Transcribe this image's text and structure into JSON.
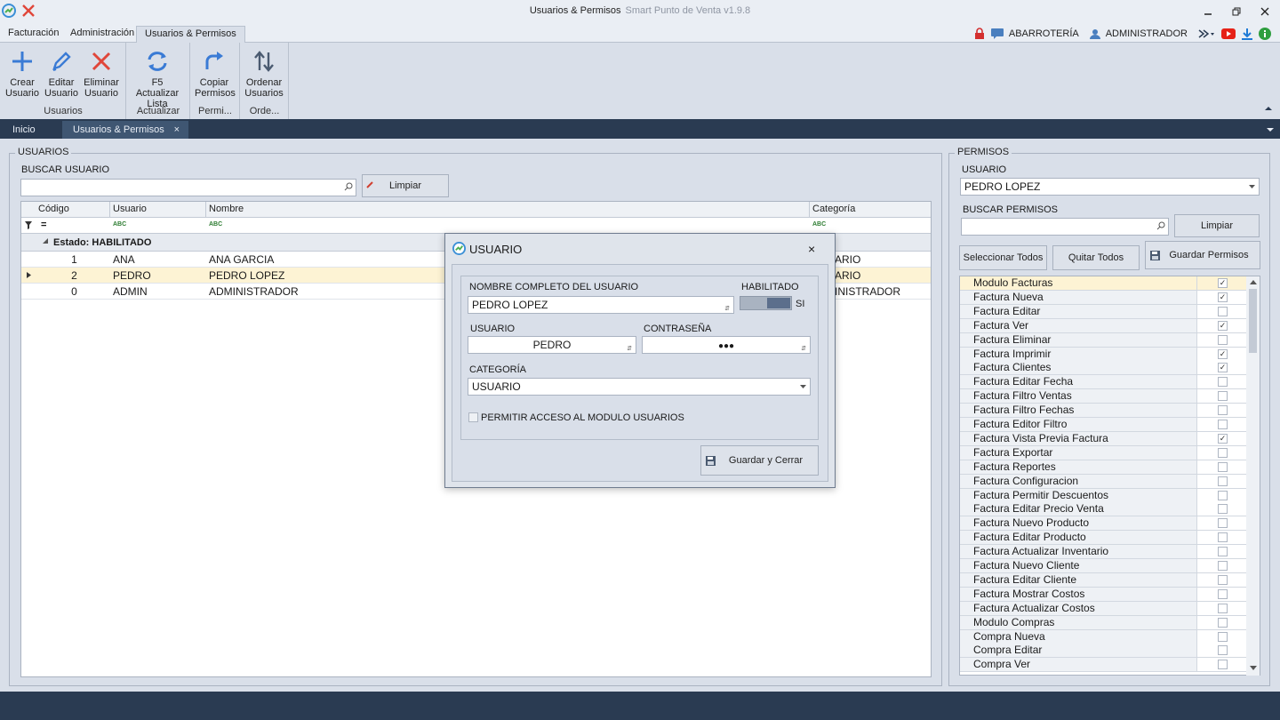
{
  "window": {
    "title": "Usuarios & Permisos",
    "app_name": "Smart Punto de Venta v1.9.8"
  },
  "ribbon_tabs": [
    "Facturación",
    "Administración",
    "Usuarios & Permisos"
  ],
  "header_right": {
    "store": "ABARROTERÍA",
    "user": "ADMINISTRADOR"
  },
  "ribbon": {
    "crear": "Crear\nUsuario",
    "editar": "Editar\nUsuario",
    "eliminar": "Eliminar\nUsuario",
    "actualizar": "F5 Actualizar\nLista",
    "copiar": "Copiar\nPermisos",
    "ordenar": "Ordenar\nUsuarios",
    "group_usuarios": "Usuarios",
    "group_actualizar": "Actualizar",
    "group_permisos": "Permi...",
    "group_orden": "Orde..."
  },
  "doc_tabs": [
    "Inicio",
    "Usuarios & Permisos"
  ],
  "usuarios_panel": {
    "title": "USUARIOS",
    "search_label": "BUSCAR USUARIO",
    "search_value": "",
    "clear_button": "Limpiar",
    "columns": [
      "Código",
      "Usuario",
      "Nombre",
      "Categoría"
    ],
    "filter_eq": "=",
    "filter_abc": "ABC",
    "group_header": "Estado: HABILITADO",
    "rows": [
      {
        "codigo": "1",
        "usuario": "ANA",
        "nombre": "ANA GARCIA",
        "categoria": "ARIO"
      },
      {
        "codigo": "2",
        "usuario": "PEDRO",
        "nombre": "PEDRO LOPEZ",
        "categoria": "ARIO"
      },
      {
        "codigo": "0",
        "usuario": "ADMIN",
        "nombre": "ADMINISTRADOR",
        "categoria": "INISTRADOR"
      }
    ]
  },
  "permisos_panel": {
    "title": "PERMISOS",
    "user_label": "USUARIO",
    "user_value": "PEDRO LOPEZ",
    "search_label": "BUSCAR PERMISOS",
    "search_value": "",
    "clear_button": "Limpiar",
    "select_all": "Seleccionar Todos",
    "remove_all": "Quitar Todos",
    "save": "Guardar Permisos",
    "items": [
      {
        "label": "Modulo Facturas",
        "checked": true
      },
      {
        "label": "Factura Nueva",
        "checked": true
      },
      {
        "label": "Factura Editar",
        "checked": false
      },
      {
        "label": "Factura Ver",
        "checked": true
      },
      {
        "label": "Factura Eliminar",
        "checked": false
      },
      {
        "label": "Factura Imprimir",
        "checked": true
      },
      {
        "label": "Factura Clientes",
        "checked": true
      },
      {
        "label": "Factura Editar Fecha",
        "checked": false
      },
      {
        "label": "Factura Filtro Ventas",
        "checked": false
      },
      {
        "label": "Factura Filtro Fechas",
        "checked": false
      },
      {
        "label": "Factura Editor Filtro",
        "checked": false
      },
      {
        "label": "Factura Vista Previa Factura",
        "checked": true
      },
      {
        "label": "Factura Exportar",
        "checked": false
      },
      {
        "label": "Factura Reportes",
        "checked": false
      },
      {
        "label": "Factura Configuracion",
        "checked": false
      },
      {
        "label": "Factura Permitir Descuentos",
        "checked": false
      },
      {
        "label": "Factura Editar Precio Venta",
        "checked": false
      },
      {
        "label": "Factura Nuevo Producto",
        "checked": false
      },
      {
        "label": "Factura Editar Producto",
        "checked": false
      },
      {
        "label": "Factura Actualizar Inventario",
        "checked": false
      },
      {
        "label": "Factura Nuevo Cliente",
        "checked": false
      },
      {
        "label": "Factura Editar Cliente",
        "checked": false
      },
      {
        "label": "Factura Mostrar Costos",
        "checked": false
      },
      {
        "label": "Factura Actualizar Costos",
        "checked": false
      },
      {
        "label": "Modulo Compras",
        "checked": false
      },
      {
        "label": "Compra Nueva",
        "checked": false
      },
      {
        "label": "Compra Editar",
        "checked": false
      },
      {
        "label": "Compra Ver",
        "checked": false
      }
    ]
  },
  "modal": {
    "title": "USUARIO",
    "full_name_label": "NOMBRE COMPLETO DEL USUARIO",
    "full_name_value": "PEDRO LOPEZ",
    "enabled_label": "HABILITADO",
    "enabled_value": "SI",
    "username_label": "USUARIO",
    "username_value": "PEDRO",
    "password_label": "CONTRASEÑA",
    "password_value": "●●●",
    "category_label": "CATEGORÍA",
    "category_value": "USUARIO",
    "module_access_label": "PERMITIR ACCESO AL MODULO USUARIOS",
    "module_access_checked": false,
    "save_button": "Guardar y Cerrar"
  },
  "colors": {
    "accent_blue": "#3a7bd5",
    "delete_red": "#e0463a",
    "selected_row": "#fdf3d4",
    "dark_bar": "#2a3b52"
  }
}
